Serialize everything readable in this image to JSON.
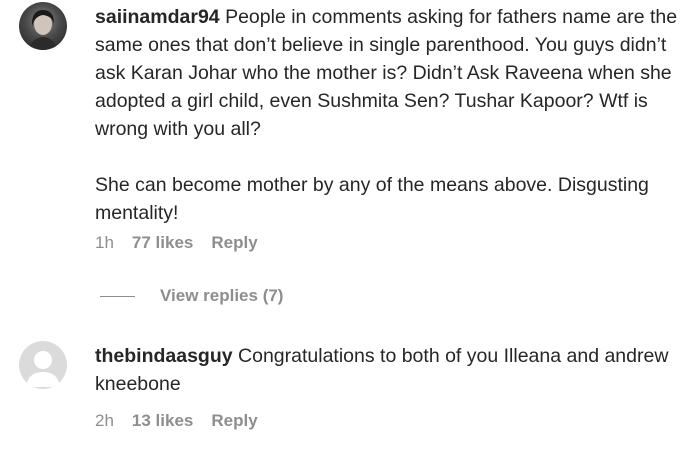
{
  "comments": [
    {
      "username": "saiinamdar94",
      "text": " People in comments asking for fathers name are the same ones that don’t believe in single parenthood. You guys didn’t ask Karan Johar who the mother is? Didn’t Ask Raveena when she adopted a girl child, even Sushmita Sen? Tushar Kapoor? Wtf is wrong with you all?",
      "text2": "She can become mother by any of the means above. Disgusting mentality!",
      "time": "1h",
      "likes": "77 likes",
      "reply_label": "Reply",
      "view_replies": "View replies (7)",
      "avatar": "profile-photo"
    },
    {
      "username": "thebindaasguy",
      "text": " Congratulations to both of you Illeana and andrew kneebone",
      "time": "2h",
      "likes": "13 likes",
      "reply_label": "Reply",
      "avatar": "default-avatar-icon"
    }
  ]
}
